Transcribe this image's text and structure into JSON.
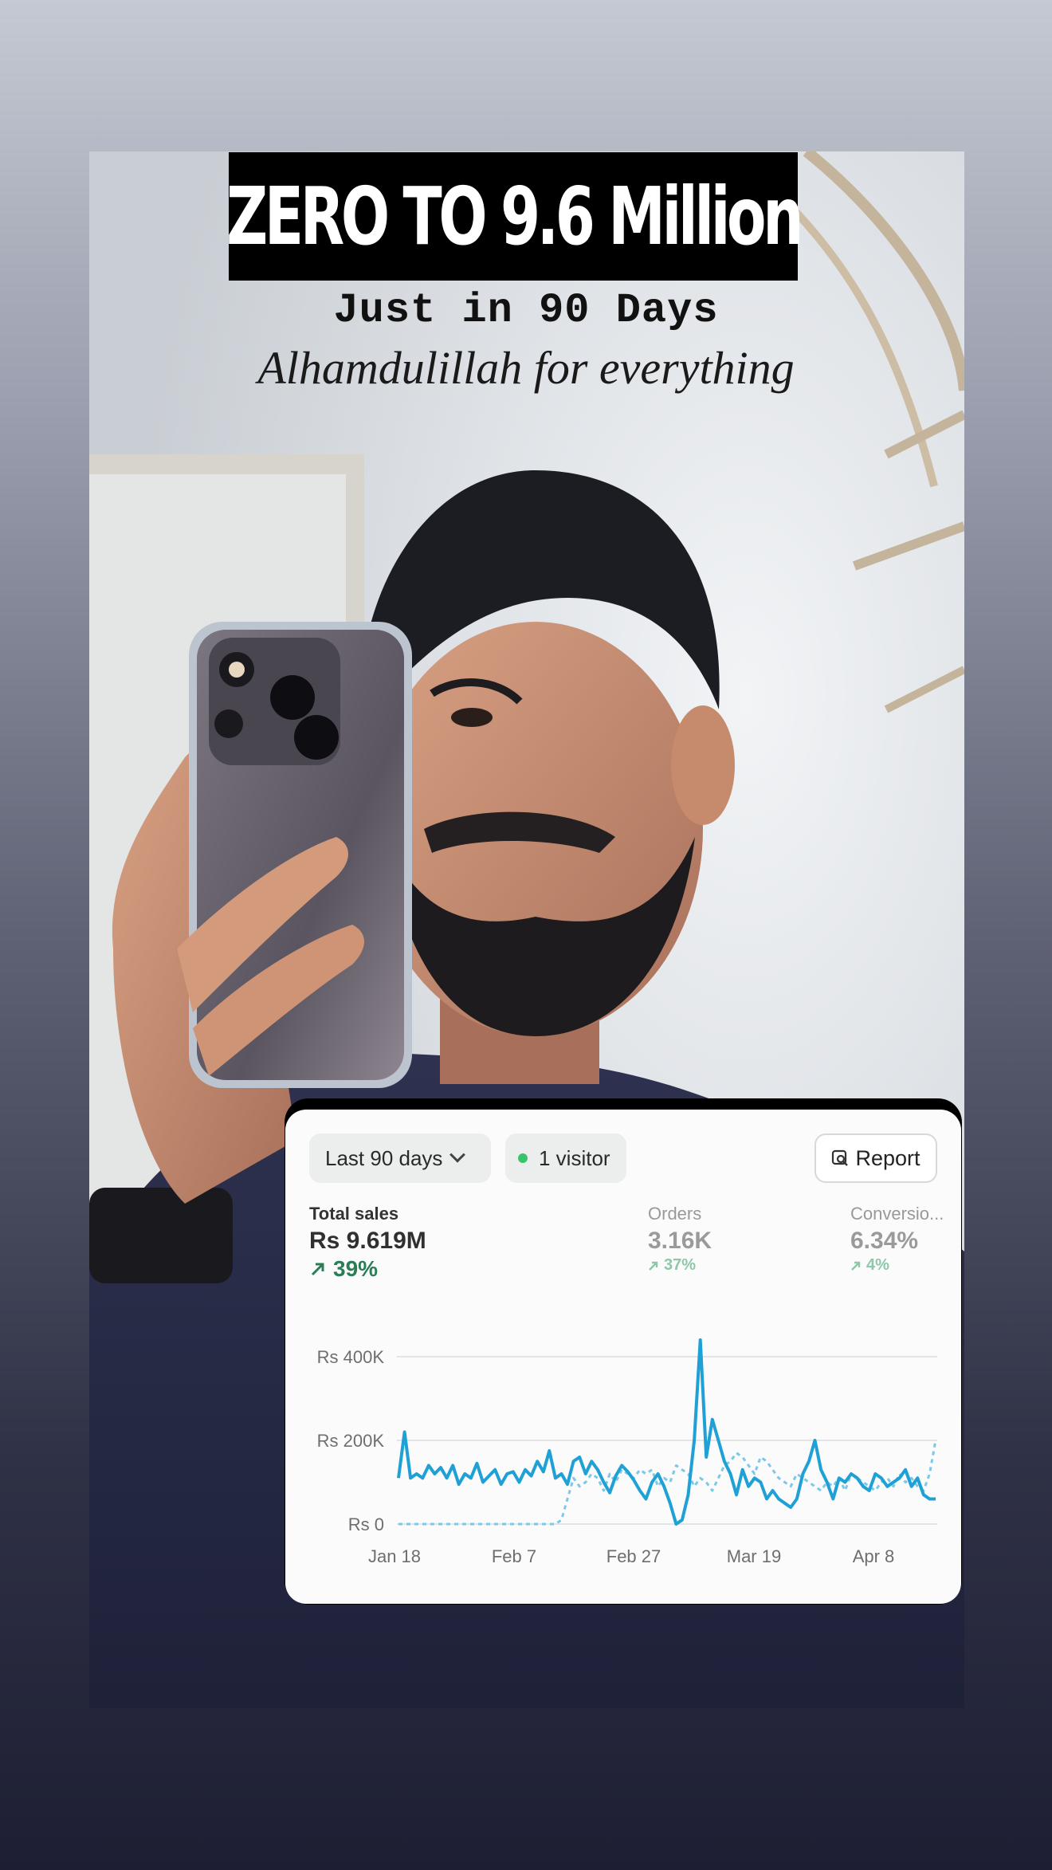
{
  "title": "ZERO TO 9.6 Million",
  "subtitle": "Just in 90 Days",
  "tagline": "Alhamdulillah for everything",
  "analytics": {
    "date_range": "Last 90 days",
    "visitors": "1 visitor",
    "report_label": "Report",
    "metrics": [
      {
        "label": "Total sales",
        "value": "Rs 9.619M",
        "change": "39%"
      },
      {
        "label": "Orders",
        "value": "3.16K",
        "change": "37%"
      },
      {
        "label": "Conversio...",
        "value": "6.34%",
        "change": "4%"
      }
    ]
  },
  "chart_data": {
    "type": "line",
    "y_ticks": [
      "Rs 400K",
      "Rs 200K",
      "Rs 0"
    ],
    "x_ticks": [
      "Jan 18",
      "Feb 7",
      "Feb 27",
      "Mar 19",
      "Apr 8"
    ],
    "ylim": [
      0,
      400000
    ],
    "series": [
      {
        "style": "solid",
        "color": "#1fa1d6",
        "values": [
          110,
          220,
          110,
          120,
          110,
          140,
          120,
          135,
          110,
          140,
          95,
          120,
          110,
          145,
          100,
          115,
          130,
          95,
          120,
          125,
          100,
          130,
          115,
          150,
          125,
          175,
          110,
          120,
          95,
          150,
          160,
          120,
          150,
          130,
          100,
          75,
          115,
          140,
          125,
          105,
          80,
          60,
          100,
          120,
          90,
          50,
          0,
          10,
          70,
          200,
          440,
          160,
          250,
          200,
          150,
          120,
          70,
          130,
          90,
          110,
          100,
          60,
          80,
          60,
          50,
          40,
          60,
          120,
          150,
          200,
          130,
          100,
          60,
          110,
          100,
          120,
          110,
          90,
          80,
          120,
          110,
          90,
          100,
          110,
          130,
          90,
          110,
          70,
          60,
          60
        ],
        "x_range": [
          "Jan 18",
          "Apr 17"
        ]
      },
      {
        "style": "dashed",
        "color": "#7cc8e6",
        "values": [
          0,
          0,
          0,
          0,
          0,
          0,
          0,
          0,
          0,
          0,
          0,
          0,
          0,
          0,
          0,
          0,
          0,
          0,
          0,
          0,
          0,
          0,
          0,
          0,
          0,
          0,
          0,
          10,
          60,
          110,
          90,
          100,
          120,
          110,
          80,
          120,
          100,
          130,
          120,
          110,
          130,
          120,
          130,
          90,
          110,
          100,
          140,
          130,
          120,
          90,
          110,
          100,
          80,
          110,
          140,
          150,
          170,
          160,
          140,
          120,
          160,
          150,
          130,
          110,
          100,
          90,
          120,
          110,
          100,
          90,
          80,
          100,
          90,
          110,
          80,
          120,
          110,
          100,
          90,
          80,
          100,
          110,
          90,
          120,
          100,
          110,
          90,
          80,
          120,
          200
        ],
        "x_range": [
          "Jan 18",
          "Apr 17"
        ]
      }
    ],
    "grid": true
  }
}
